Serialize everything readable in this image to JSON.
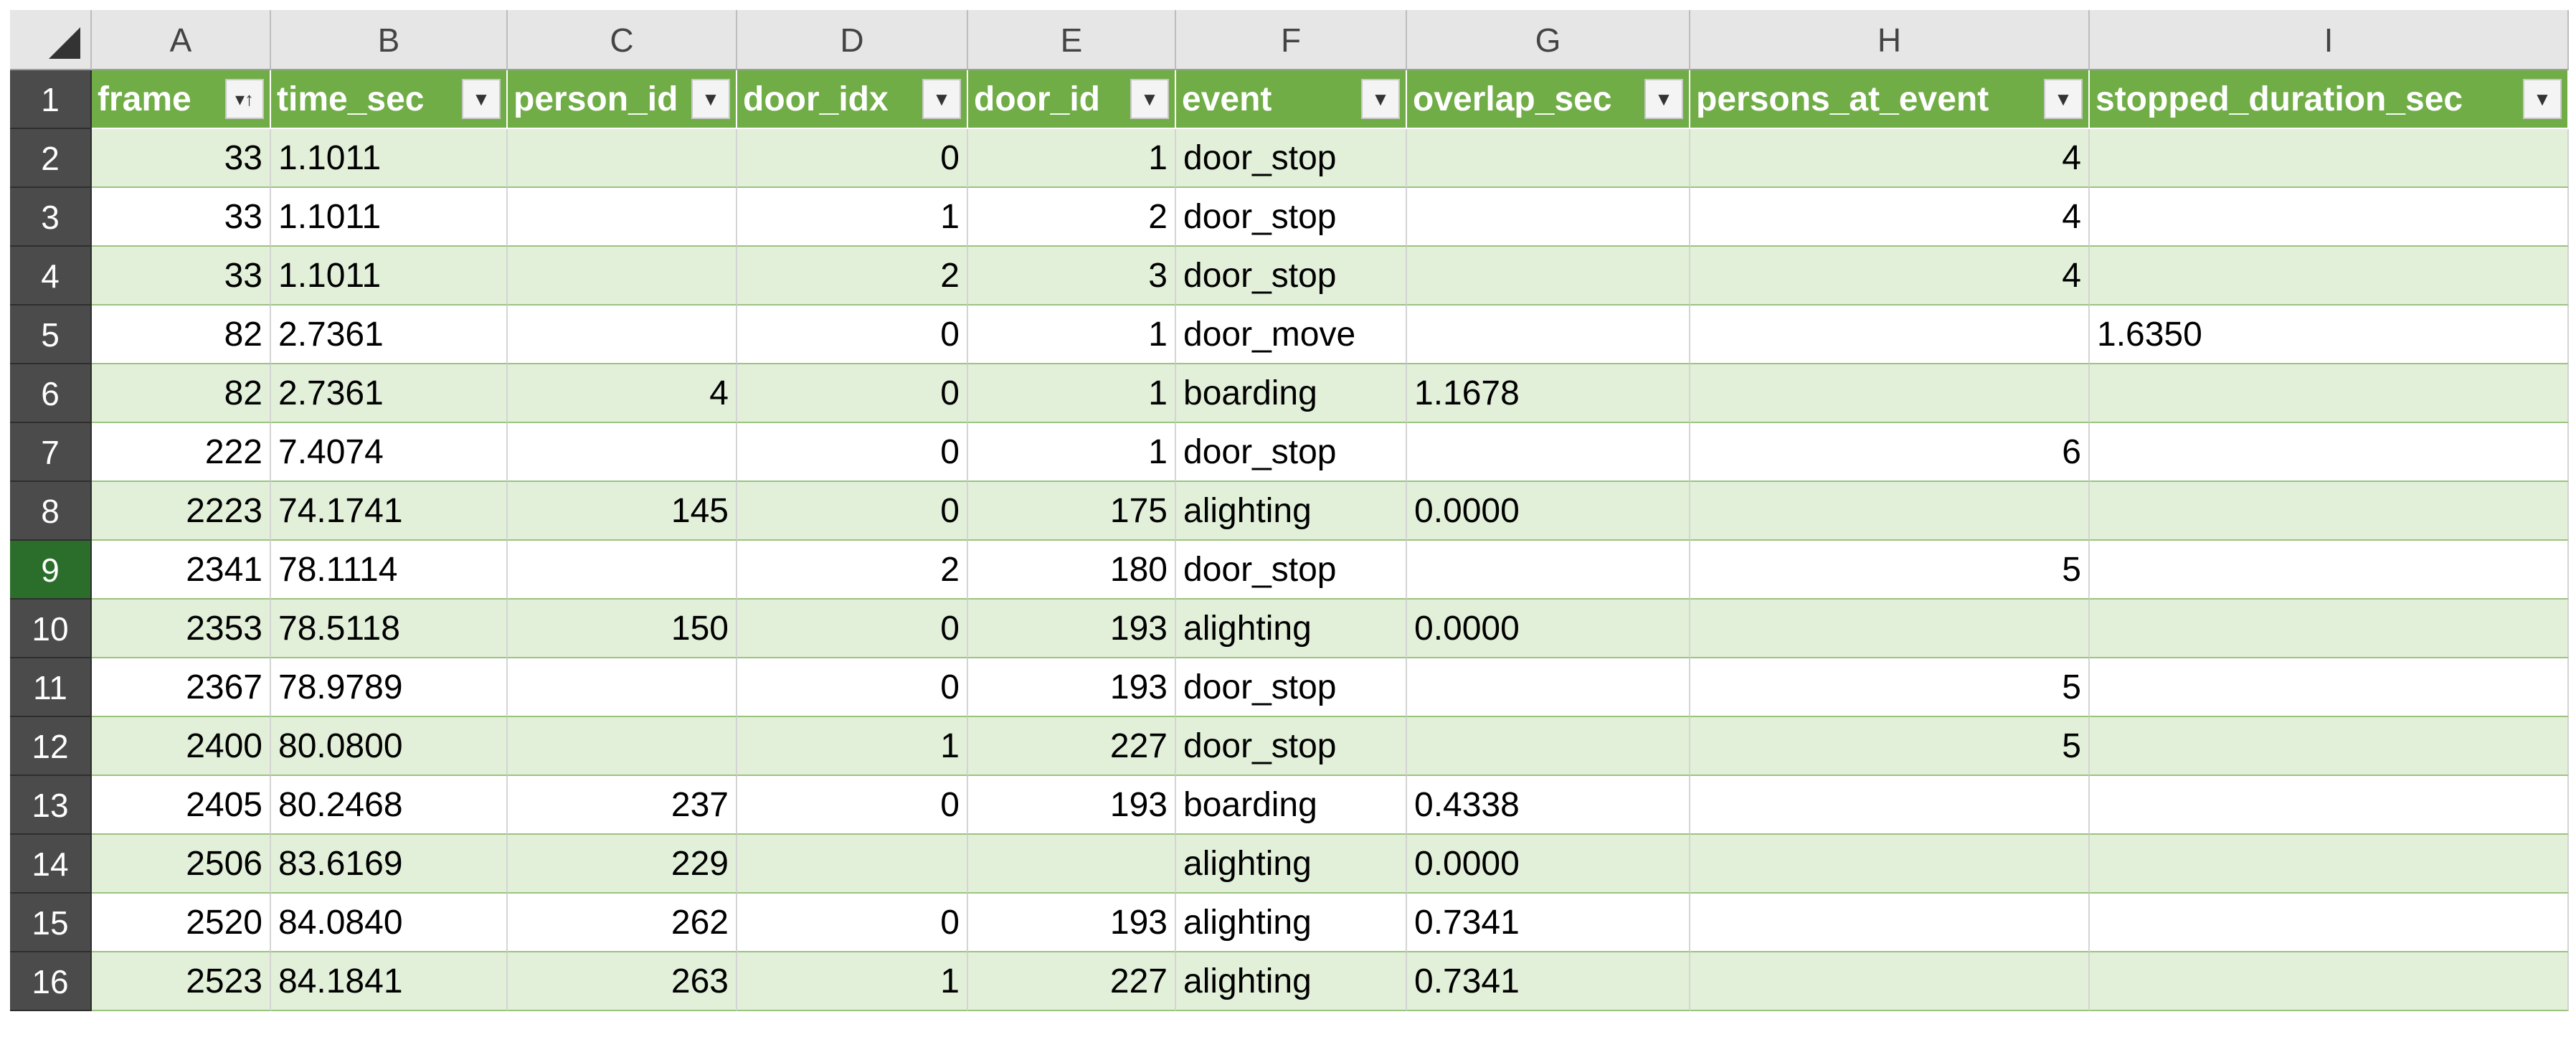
{
  "columns": [
    "A",
    "B",
    "C",
    "D",
    "E",
    "F",
    "G",
    "H",
    "I"
  ],
  "headers": [
    "frame",
    "time_sec",
    "person_id",
    "door_idx",
    "door_id",
    "event",
    "overlap_sec",
    "persons_at_event",
    "stopped_duration_sec"
  ],
  "sorted_column_icon": "sort-ascending-filter-icon",
  "filter_icon": "filter-dropdown-icon",
  "active_row": 9,
  "rows": [
    {
      "n": "2",
      "frame": "33",
      "time_sec": "1.1011",
      "person_id": "",
      "door_idx": "0",
      "door_id": "1",
      "event": "door_stop",
      "overlap_sec": "",
      "persons_at_event": "4",
      "stopped_duration_sec": ""
    },
    {
      "n": "3",
      "frame": "33",
      "time_sec": "1.1011",
      "person_id": "",
      "door_idx": "1",
      "door_id": "2",
      "event": "door_stop",
      "overlap_sec": "",
      "persons_at_event": "4",
      "stopped_duration_sec": ""
    },
    {
      "n": "4",
      "frame": "33",
      "time_sec": "1.1011",
      "person_id": "",
      "door_idx": "2",
      "door_id": "3",
      "event": "door_stop",
      "overlap_sec": "",
      "persons_at_event": "4",
      "stopped_duration_sec": ""
    },
    {
      "n": "5",
      "frame": "82",
      "time_sec": "2.7361",
      "person_id": "",
      "door_idx": "0",
      "door_id": "1",
      "event": "door_move",
      "overlap_sec": "",
      "persons_at_event": "",
      "stopped_duration_sec": "1.6350"
    },
    {
      "n": "6",
      "frame": "82",
      "time_sec": "2.7361",
      "person_id": "4",
      "door_idx": "0",
      "door_id": "1",
      "event": "boarding",
      "overlap_sec": "1.1678",
      "persons_at_event": "",
      "stopped_duration_sec": ""
    },
    {
      "n": "7",
      "frame": "222",
      "time_sec": "7.4074",
      "person_id": "",
      "door_idx": "0",
      "door_id": "1",
      "event": "door_stop",
      "overlap_sec": "",
      "persons_at_event": "6",
      "stopped_duration_sec": ""
    },
    {
      "n": "8",
      "frame": "2223",
      "time_sec": "74.1741",
      "person_id": "145",
      "door_idx": "0",
      "door_id": "175",
      "event": "alighting",
      "overlap_sec": "0.0000",
      "persons_at_event": "",
      "stopped_duration_sec": ""
    },
    {
      "n": "9",
      "frame": "2341",
      "time_sec": "78.1114",
      "person_id": "",
      "door_idx": "2",
      "door_id": "180",
      "event": "door_stop",
      "overlap_sec": "",
      "persons_at_event": "5",
      "stopped_duration_sec": ""
    },
    {
      "n": "10",
      "frame": "2353",
      "time_sec": "78.5118",
      "person_id": "150",
      "door_idx": "0",
      "door_id": "193",
      "event": "alighting",
      "overlap_sec": "0.0000",
      "persons_at_event": "",
      "stopped_duration_sec": ""
    },
    {
      "n": "11",
      "frame": "2367",
      "time_sec": "78.9789",
      "person_id": "",
      "door_idx": "0",
      "door_id": "193",
      "event": "door_stop",
      "overlap_sec": "",
      "persons_at_event": "5",
      "stopped_duration_sec": ""
    },
    {
      "n": "12",
      "frame": "2400",
      "time_sec": "80.0800",
      "person_id": "",
      "door_idx": "1",
      "door_id": "227",
      "event": "door_stop",
      "overlap_sec": "",
      "persons_at_event": "5",
      "stopped_duration_sec": ""
    },
    {
      "n": "13",
      "frame": "2405",
      "time_sec": "80.2468",
      "person_id": "237",
      "door_idx": "0",
      "door_id": "193",
      "event": "boarding",
      "overlap_sec": "0.4338",
      "persons_at_event": "",
      "stopped_duration_sec": ""
    },
    {
      "n": "14",
      "frame": "2506",
      "time_sec": "83.6169",
      "person_id": "229",
      "door_idx": "",
      "door_id": "",
      "event": "alighting",
      "overlap_sec": "0.0000",
      "persons_at_event": "",
      "stopped_duration_sec": ""
    },
    {
      "n": "15",
      "frame": "2520",
      "time_sec": "84.0840",
      "person_id": "262",
      "door_idx": "0",
      "door_id": "193",
      "event": "alighting",
      "overlap_sec": "0.7341",
      "persons_at_event": "",
      "stopped_duration_sec": ""
    },
    {
      "n": "16",
      "frame": "2523",
      "time_sec": "84.1841",
      "person_id": "263",
      "door_idx": "1",
      "door_id": "227",
      "event": "alighting",
      "overlap_sec": "0.7341",
      "persons_at_event": "",
      "stopped_duration_sec": ""
    }
  ],
  "colors": {
    "header_green": "#70ad47",
    "band_green": "#e2efd9",
    "row_header_dark": "#4b4b4b",
    "active_row_header": "#2b6e2b"
  }
}
